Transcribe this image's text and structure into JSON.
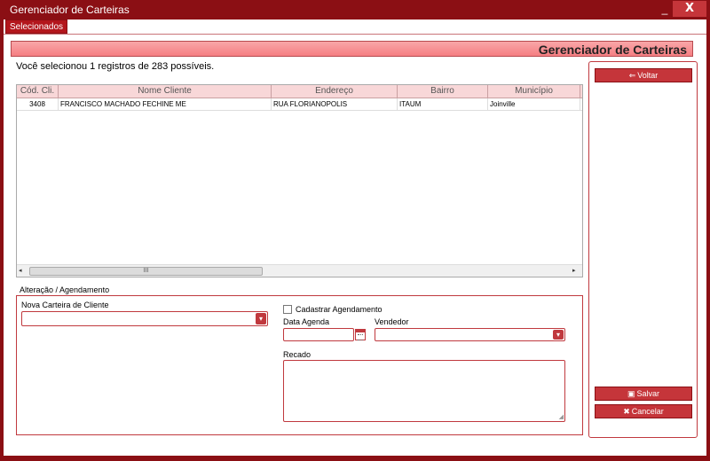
{
  "window": {
    "title": "Gerenciador de Carteiras",
    "minimize": "_",
    "close": "X"
  },
  "tab": {
    "label": "Selecionados"
  },
  "header": {
    "title": "Gerenciador de Carteiras"
  },
  "selection_info": "Você selecionou 1 registros de 283 possíveis.",
  "grid": {
    "columns": [
      "Cód. Cli.",
      "Nome Cliente",
      "Endereço",
      "Bairro",
      "Município"
    ],
    "rows": [
      [
        "3408",
        "FRANCISCO MACHADO FECHINE ME",
        "RUA FLORIANOPOLIS",
        "ITAUM",
        "Joinville"
      ]
    ],
    "scroll_left": "◂",
    "scroll_right": "▸",
    "scroll_thumb": "III"
  },
  "form": {
    "group_title": "Alteração / Agendamento",
    "nova_carteira_label": "Nova Carteira de Cliente",
    "nova_carteira_value": "",
    "cadastrar_label": "Cadastrar Agendamento",
    "cadastrar_checked": false,
    "data_agenda_label": "Data Agenda",
    "data_agenda_value": "",
    "vendedor_label": "Vendedor",
    "vendedor_value": "",
    "recado_label": "Recado",
    "recado_value": ""
  },
  "side": {
    "voltar_label": "Voltar",
    "salvar_label": "Salvar",
    "cancelar_label": "Cancelar"
  },
  "colors": {
    "accent": "#c5353a",
    "frame": "#8b0f14",
    "header_band": "#f57e82"
  }
}
